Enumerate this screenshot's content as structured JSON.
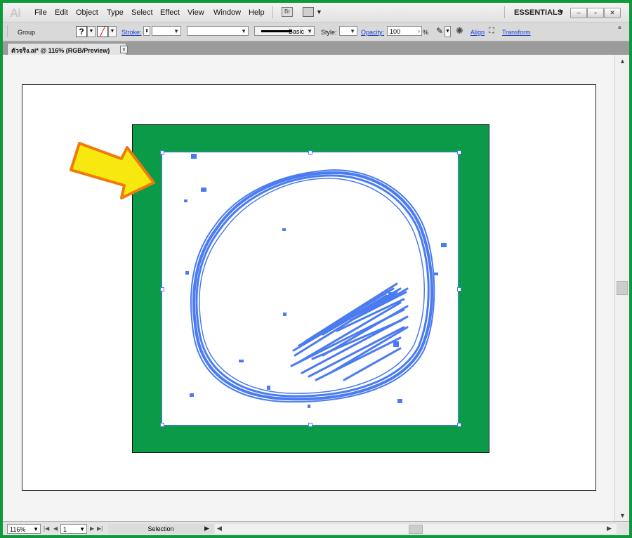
{
  "app": {
    "logo": "Ai",
    "menu": [
      "File",
      "Edit",
      "Object",
      "Type",
      "Select",
      "Effect",
      "View",
      "Window",
      "Help"
    ],
    "bridge_label": "Br",
    "workspace": "ESSENTIALS",
    "window_buttons": [
      "minimize",
      "restore",
      "close"
    ]
  },
  "control": {
    "selection_type": "Group",
    "fill_swatch": "?",
    "stroke_label": "Stroke:",
    "stroke_profile": "Basic",
    "style_label": "Style:",
    "opacity_label": "Opacity:",
    "opacity_value": "100",
    "opacity_unit": "%",
    "align_label": "Align",
    "transform_label": "Transform"
  },
  "document": {
    "tab_title": "ตัวจริง.ai* @ 116% (RGB/Preview)",
    "tab_close": "×"
  },
  "status": {
    "zoom": "116%",
    "artboard_number": "1",
    "tool_label": "Selection"
  },
  "colors": {
    "frame_green": "#0e9a3a",
    "artwork_green": "#0b9a48",
    "path_blue": "#4a7bf0",
    "callout_arrow_fill": "#f7e90f",
    "callout_arrow_stroke": "#f07a0a"
  },
  "icons": {
    "stroke_none": "slash-swatch-icon",
    "recolor": "recolor-artwork-icon",
    "isolate": "isolate-group-icon",
    "transform": "transform-icon",
    "callout": "yellow-arrow-icon"
  }
}
